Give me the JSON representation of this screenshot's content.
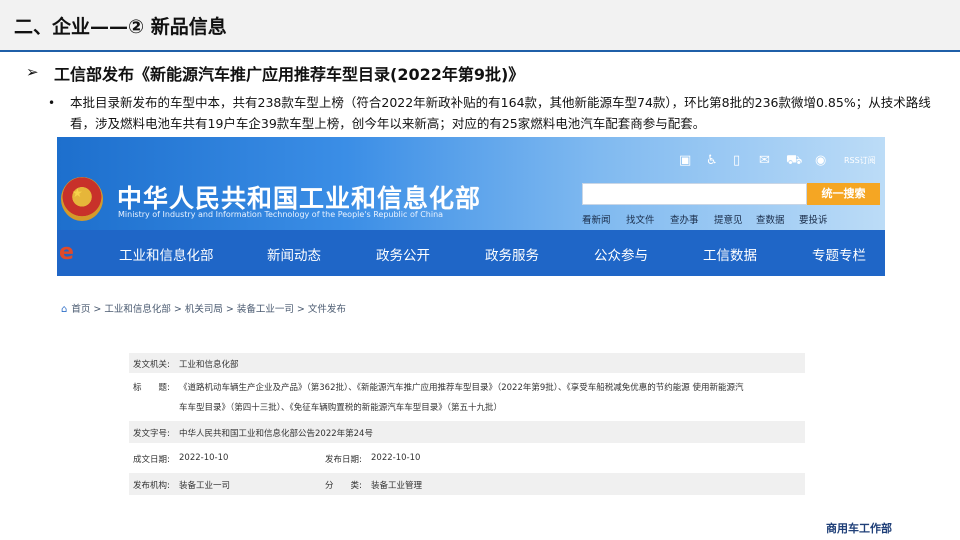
{
  "slide": {
    "title": "二、企业——② 新品信息",
    "bullet_arrow": "➢",
    "sub_heading": "工信部发布《新能源汽车推广应用推荐车型目录(2022年第9批)》",
    "dot": "•",
    "body": "本批目录新发布的车型中本，共有238款车型上榜（符合2022年新政补贴的有164款，其他新能源车型74款），环比第8批的236款微增0.85%；从技术路线看，涉及燃料电池车共有19户车企39款车型上榜，创今年以来新高；对应的有25家燃料电池汽车配套商参与配套。",
    "footer": "商用车工作部"
  },
  "miit": {
    "name_cn": "中华人民共和国工业和信息化部",
    "name_en": "Ministry of Industry and Information Technology of the People's Republic of China",
    "rss": "RSS订阅",
    "search_button": "统一搜索",
    "quick_links": [
      "看新闻",
      "找文件",
      "查办事",
      "提意见",
      "查数据",
      "要投诉"
    ],
    "nav": [
      "工业和信息化部",
      "新闻动态",
      "政务公开",
      "政务服务",
      "公众参与",
      "工信数据",
      "专题专栏"
    ],
    "breadcrumb": "首页 > 工业和信息化部 > 机关司局 > 装备工业一司 > 文件发布",
    "doc": {
      "issuer_label": "发文机关:",
      "issuer": "工业和信息化部",
      "title_label": "标　　题:",
      "title_line1": "《道路机动车辆生产企业及产品》（第362批）、《新能源汽车推广应用推荐车型目录》（2022年第9批）、《享受车船税减免优惠的节约能源 使用新能源汽",
      "title_line2": "车车型目录》（第四十三批）、《免征车辆购置税的新能源汽车车型目录》（第五十九批）",
      "number_label": "发文字号:",
      "number": "中华人民共和国工业和信息化部公告2022年第24号",
      "created_label": "成文日期:",
      "created": "2022-10-10",
      "published_label": "发布日期:",
      "published": "2022-10-10",
      "org_label": "发布机构:",
      "org": "装备工业一司",
      "category_label": "分　　类:",
      "category": "装备工业管理"
    }
  },
  "icons": [
    "mobile-icon",
    "accessibility-icon",
    "phone-icon",
    "mail-icon",
    "cart-icon",
    "weibo-icon",
    "home-icon"
  ],
  "colors": {
    "header_rule": "#1f5fa8",
    "nav_blue": "#1f66c7",
    "search_orange": "#f5a623",
    "footer_text": "#1f3f78"
  }
}
